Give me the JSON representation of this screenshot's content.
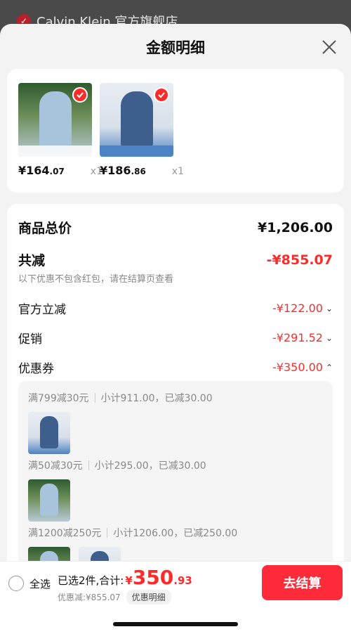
{
  "backdrop": {
    "store_name": "Calvin Klein 官方旗舰店"
  },
  "sheet": {
    "title": "金额明细"
  },
  "products": [
    {
      "price_int": "¥164",
      "price_dec": ".07",
      "qty": "x1"
    },
    {
      "price_int": "¥186",
      "price_dec": ".86",
      "qty": "x1"
    }
  ],
  "summary_rows": {
    "total_label": "商品总价",
    "total_value": "¥1,206.00",
    "reduce_label": "共减",
    "reduce_value": "-¥855.07",
    "reduce_note": "以下优惠不包含红包，请在结算页查看",
    "official_label": "官方立减",
    "official_value": "-¥122.00",
    "promo_label": "促销",
    "promo_value": "-¥291.52",
    "coupon_label": "优惠券",
    "coupon_value": "-¥350.00"
  },
  "coupon_details": [
    {
      "rule": "满799减30元",
      "detail": "小计911.00，已减30.00"
    },
    {
      "rule": "满50减30元",
      "detail": "小计295.00，已减30.00"
    },
    {
      "rule": "满1200减250元",
      "detail": "小计1206.00，已减250.00"
    }
  ],
  "bottom_bar": {
    "select_all": "全选",
    "selected_text": "已选2件,合计:",
    "amount_cur": "¥",
    "amount_int": "350",
    "amount_dec": ".93",
    "discount_text": "优惠减:¥855.07",
    "detail_link": "优惠明细",
    "checkout": "去结算"
  },
  "icons": {
    "close": "close-icon",
    "check": "check-icon",
    "chevron_down": "chevron-down-icon",
    "chevron_up": "chevron-up-icon"
  },
  "colors": {
    "accent_red": "#ff2a2a",
    "checkout_red": "#ff2a3a"
  }
}
